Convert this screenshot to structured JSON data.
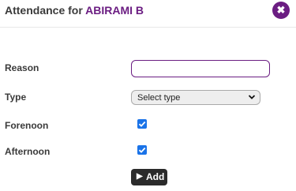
{
  "header": {
    "title_prefix": "Attendance for ",
    "student_name": "ABIRAMI B",
    "close_icon": "✖"
  },
  "form": {
    "reason_label": "Reason",
    "reason_value": "",
    "type_label": "Type",
    "type_selected": "Select type",
    "forenoon_label": "Forenoon",
    "forenoon_checked": true,
    "afternoon_label": "Afternoon",
    "afternoon_checked": true,
    "add_button_icon": "▶",
    "add_button_label": "Add"
  },
  "colors": {
    "accent": "#6b1d82",
    "checkbox": "#1a73e8",
    "button_bg": "#2b2b2b"
  }
}
